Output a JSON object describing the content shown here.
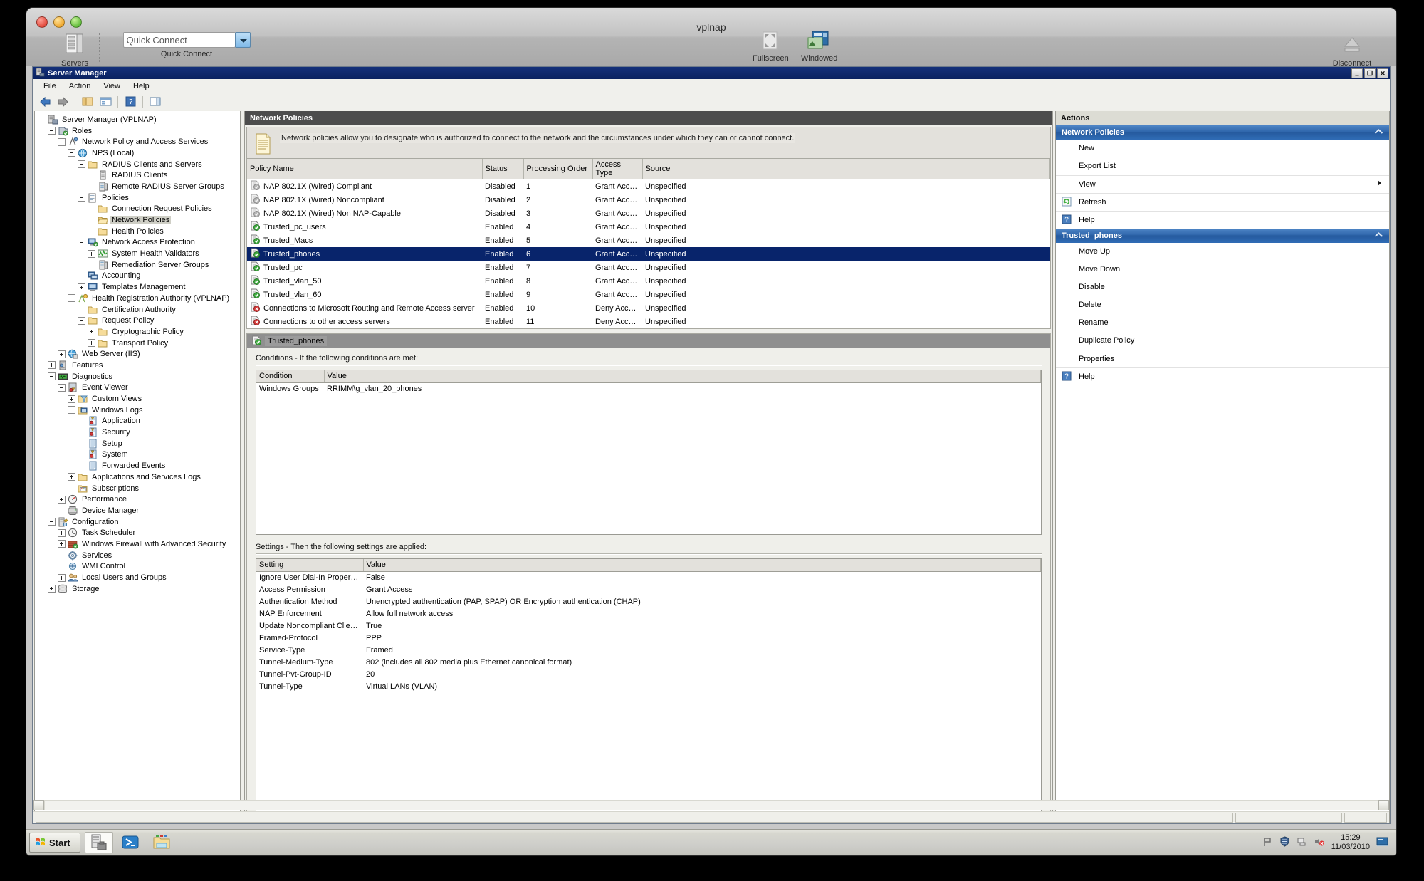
{
  "rdp": {
    "title": "vplnap",
    "servers_label": "Servers",
    "quick_connect_value": "Quick Connect",
    "quick_connect_label": "Quick Connect",
    "fullscreen_label": "Fullscreen",
    "windowed_label": "Windowed",
    "disconnect_label": "Disconnect"
  },
  "mmc": {
    "title": "Server Manager",
    "minimize": "_",
    "restore": "❐",
    "close": "✕",
    "menu": [
      "File",
      "Action",
      "View",
      "Help"
    ]
  },
  "tree": [
    {
      "label": "Server Manager (VPLNAP)",
      "indent": 0,
      "exp": "none",
      "icon": "server-icon",
      "sel": false
    },
    {
      "label": "Roles",
      "indent": 1,
      "exp": "minus",
      "icon": "roles-icon",
      "sel": false
    },
    {
      "label": "Network Policy and Access Services",
      "indent": 2,
      "exp": "minus",
      "icon": "nps-role-icon",
      "sel": false
    },
    {
      "label": "NPS (Local)",
      "indent": 3,
      "exp": "minus",
      "icon": "globe-icon",
      "sel": false
    },
    {
      "label": "RADIUS Clients and Servers",
      "indent": 4,
      "exp": "minus",
      "icon": "folder-icon",
      "sel": false
    },
    {
      "label": "RADIUS Clients",
      "indent": 5,
      "exp": "none",
      "icon": "client-icon",
      "sel": false
    },
    {
      "label": "Remote RADIUS Server Groups",
      "indent": 5,
      "exp": "none",
      "icon": "server-group-icon",
      "sel": false
    },
    {
      "label": "Policies",
      "indent": 4,
      "exp": "minus",
      "icon": "policies-icon",
      "sel": false
    },
    {
      "label": "Connection Request Policies",
      "indent": 5,
      "exp": "none",
      "icon": "folder-icon",
      "sel": false
    },
    {
      "label": "Network Policies",
      "indent": 5,
      "exp": "none",
      "icon": "folder-open-icon",
      "sel": true
    },
    {
      "label": "Health Policies",
      "indent": 5,
      "exp": "none",
      "icon": "folder-icon",
      "sel": false
    },
    {
      "label": "Network Access Protection",
      "indent": 4,
      "exp": "minus",
      "icon": "nap-icon",
      "sel": false
    },
    {
      "label": "System Health Validators",
      "indent": 5,
      "exp": "plus",
      "icon": "shv-icon",
      "sel": false
    },
    {
      "label": "Remediation Server Groups",
      "indent": 5,
      "exp": "none",
      "icon": "server-group-icon",
      "sel": false
    },
    {
      "label": "Accounting",
      "indent": 4,
      "exp": "none",
      "icon": "accounting-icon",
      "sel": false
    },
    {
      "label": "Templates Management",
      "indent": 4,
      "exp": "plus",
      "icon": "templates-icon",
      "sel": false
    },
    {
      "label": "Health Registration Authority (VPLNAP)",
      "indent": 3,
      "exp": "minus",
      "icon": "hra-icon",
      "sel": false
    },
    {
      "label": "Certification Authority",
      "indent": 4,
      "exp": "none",
      "icon": "folder-icon",
      "sel": false
    },
    {
      "label": "Request Policy",
      "indent": 4,
      "exp": "minus",
      "icon": "folder-icon",
      "sel": false
    },
    {
      "label": "Cryptographic Policy",
      "indent": 5,
      "exp": "plus",
      "icon": "folder-icon",
      "sel": false
    },
    {
      "label": "Transport Policy",
      "indent": 5,
      "exp": "plus",
      "icon": "folder-icon",
      "sel": false
    },
    {
      "label": "Web Server (IIS)",
      "indent": 2,
      "exp": "plus",
      "icon": "iis-icon",
      "sel": false
    },
    {
      "label": "Features",
      "indent": 1,
      "exp": "plus",
      "icon": "features-icon",
      "sel": false
    },
    {
      "label": "Diagnostics",
      "indent": 1,
      "exp": "minus",
      "icon": "diagnostics-icon",
      "sel": false
    },
    {
      "label": "Event Viewer",
      "indent": 2,
      "exp": "minus",
      "icon": "event-viewer-icon",
      "sel": false
    },
    {
      "label": "Custom Views",
      "indent": 3,
      "exp": "plus",
      "icon": "custom-views-icon",
      "sel": false
    },
    {
      "label": "Windows Logs",
      "indent": 3,
      "exp": "minus",
      "icon": "windows-logs-icon",
      "sel": false
    },
    {
      "label": "Application",
      "indent": 4,
      "exp": "none",
      "icon": "log-warning-icon",
      "sel": false
    },
    {
      "label": "Security",
      "indent": 4,
      "exp": "none",
      "icon": "log-warning-icon",
      "sel": false
    },
    {
      "label": "Setup",
      "indent": 4,
      "exp": "none",
      "icon": "log-icon",
      "sel": false
    },
    {
      "label": "System",
      "indent": 4,
      "exp": "none",
      "icon": "log-warning-icon",
      "sel": false
    },
    {
      "label": "Forwarded Events",
      "indent": 4,
      "exp": "none",
      "icon": "log-icon",
      "sel": false
    },
    {
      "label": "Applications and Services Logs",
      "indent": 3,
      "exp": "plus",
      "icon": "folder-icon",
      "sel": false
    },
    {
      "label": "Subscriptions",
      "indent": 3,
      "exp": "none",
      "icon": "subscriptions-icon",
      "sel": false
    },
    {
      "label": "Performance",
      "indent": 2,
      "exp": "plus",
      "icon": "performance-icon",
      "sel": false
    },
    {
      "label": "Device Manager",
      "indent": 2,
      "exp": "none",
      "icon": "device-manager-icon",
      "sel": false
    },
    {
      "label": "Configuration",
      "indent": 1,
      "exp": "minus",
      "icon": "configuration-icon",
      "sel": false
    },
    {
      "label": "Task Scheduler",
      "indent": 2,
      "exp": "plus",
      "icon": "clock-icon",
      "sel": false
    },
    {
      "label": "Windows Firewall with Advanced Security",
      "indent": 2,
      "exp": "plus",
      "icon": "firewall-icon",
      "sel": false
    },
    {
      "label": "Services",
      "indent": 2,
      "exp": "none",
      "icon": "services-icon",
      "sel": false
    },
    {
      "label": "WMI Control",
      "indent": 2,
      "exp": "none",
      "icon": "wmi-icon",
      "sel": false
    },
    {
      "label": "Local Users and Groups",
      "indent": 2,
      "exp": "plus",
      "icon": "users-icon",
      "sel": false
    },
    {
      "label": "Storage",
      "indent": 1,
      "exp": "plus",
      "icon": "storage-icon",
      "sel": false
    }
  ],
  "main": {
    "header": "Network Policies",
    "description": "Network policies allow you to designate who is authorized to connect to the network and the circumstances under which they can or cannot connect.",
    "columns": [
      "Policy Name",
      "Status",
      "Processing Order",
      "Access Type",
      "Source"
    ],
    "rows": [
      {
        "name": "NAP 802.1X (Wired) Compliant",
        "status": "Disabled",
        "order": "1",
        "access": "Grant Access",
        "source": "Unspecified",
        "state": "disabled",
        "selected": false
      },
      {
        "name": "NAP 802.1X (Wired) Noncompliant",
        "status": "Disabled",
        "order": "2",
        "access": "Grant Access",
        "source": "Unspecified",
        "state": "disabled",
        "selected": false
      },
      {
        "name": "NAP 802.1X (Wired) Non NAP-Capable",
        "status": "Disabled",
        "order": "3",
        "access": "Grant Access",
        "source": "Unspecified",
        "state": "disabled",
        "selected": false
      },
      {
        "name": "Trusted_pc_users",
        "status": "Enabled",
        "order": "4",
        "access": "Grant Access",
        "source": "Unspecified",
        "state": "granted",
        "selected": false
      },
      {
        "name": "Trusted_Macs",
        "status": "Enabled",
        "order": "5",
        "access": "Grant Access",
        "source": "Unspecified",
        "state": "granted",
        "selected": false
      },
      {
        "name": "Trusted_phones",
        "status": "Enabled",
        "order": "6",
        "access": "Grant Access",
        "source": "Unspecified",
        "state": "granted",
        "selected": true
      },
      {
        "name": "Trusted_pc",
        "status": "Enabled",
        "order": "7",
        "access": "Grant Access",
        "source": "Unspecified",
        "state": "granted",
        "selected": false
      },
      {
        "name": "Trusted_vlan_50",
        "status": "Enabled",
        "order": "8",
        "access": "Grant Access",
        "source": "Unspecified",
        "state": "granted",
        "selected": false
      },
      {
        "name": "Trusted_vlan_60",
        "status": "Enabled",
        "order": "9",
        "access": "Grant Access",
        "source": "Unspecified",
        "state": "granted",
        "selected": false
      },
      {
        "name": "Connections to Microsoft Routing and Remote Access server",
        "status": "Enabled",
        "order": "10",
        "access": "Deny Access",
        "source": "Unspecified",
        "state": "denied",
        "selected": false
      },
      {
        "name": "Connections to other access servers",
        "status": "Enabled",
        "order": "11",
        "access": "Deny Access",
        "source": "Unspecified",
        "state": "denied",
        "selected": false
      }
    ]
  },
  "detail": {
    "title": "Trusted_phones",
    "conditions_label": "Conditions - If the following conditions are met:",
    "conditions_columns": [
      "Condition",
      "Value"
    ],
    "conditions": [
      {
        "condition": "Windows Groups",
        "value": "RRIMM\\g_vlan_20_phones"
      }
    ],
    "settings_label": "Settings - Then the following settings are applied:",
    "settings_columns": [
      "Setting",
      "Value"
    ],
    "settings": [
      {
        "setting": "Ignore User Dial-In Properties",
        "value": "False"
      },
      {
        "setting": "Access Permission",
        "value": "Grant Access"
      },
      {
        "setting": "Authentication Method",
        "value": "Unencrypted authentication (PAP, SPAP) OR Encryption authentication (CHAP)"
      },
      {
        "setting": "NAP Enforcement",
        "value": "Allow full network access"
      },
      {
        "setting": "Update Noncompliant Clients",
        "value": "True"
      },
      {
        "setting": "Framed-Protocol",
        "value": "PPP"
      },
      {
        "setting": "Service-Type",
        "value": "Framed"
      },
      {
        "setting": "Tunnel-Medium-Type",
        "value": "802 (includes all 802 media plus Ethernet canonical format)"
      },
      {
        "setting": "Tunnel-Pvt-Group-ID",
        "value": "20"
      },
      {
        "setting": "Tunnel-Type",
        "value": "Virtual LANs (VLAN)"
      }
    ]
  },
  "actions": {
    "title": "Actions",
    "groups": [
      {
        "name": "Network Policies",
        "items": [
          {
            "label": "New",
            "icon": null,
            "submenu": false,
            "sep": false
          },
          {
            "label": "Export List",
            "icon": null,
            "submenu": false,
            "sep": false
          },
          {
            "label": "View",
            "icon": null,
            "submenu": true,
            "sep": true
          },
          {
            "label": "Refresh",
            "icon": "refresh-icon",
            "submenu": false,
            "sep": true
          },
          {
            "label": "Help",
            "icon": "help-icon",
            "submenu": false,
            "sep": true
          }
        ]
      },
      {
        "name": "Trusted_phones",
        "items": [
          {
            "label": "Move Up",
            "icon": null,
            "submenu": false,
            "sep": false
          },
          {
            "label": "Move Down",
            "icon": null,
            "submenu": false,
            "sep": false
          },
          {
            "label": "Disable",
            "icon": null,
            "submenu": false,
            "sep": false
          },
          {
            "label": "Delete",
            "icon": null,
            "submenu": false,
            "sep": false
          },
          {
            "label": "Rename",
            "icon": null,
            "submenu": false,
            "sep": false
          },
          {
            "label": "Duplicate Policy",
            "icon": null,
            "submenu": false,
            "sep": false
          },
          {
            "label": "Properties",
            "icon": null,
            "submenu": false,
            "sep": true
          },
          {
            "label": "Help",
            "icon": "help-icon",
            "submenu": false,
            "sep": true
          }
        ]
      }
    ]
  },
  "taskbar": {
    "start_label": "Start",
    "tasks": [
      "server-manager-icon",
      "powershell-icon",
      "explorer-icon"
    ],
    "tray": [
      "flag-icon",
      "shield-icon",
      "network-icon",
      "volume-muted-icon"
    ],
    "time": "15:29",
    "date": "11/03/2010",
    "show_desktop": "show-desktop-icon"
  },
  "colors": {
    "accent_blue": "#08246b",
    "action_header": "#2f66ab",
    "mmc_title": "#0a2260",
    "header_bar": "#4d4d4d"
  }
}
